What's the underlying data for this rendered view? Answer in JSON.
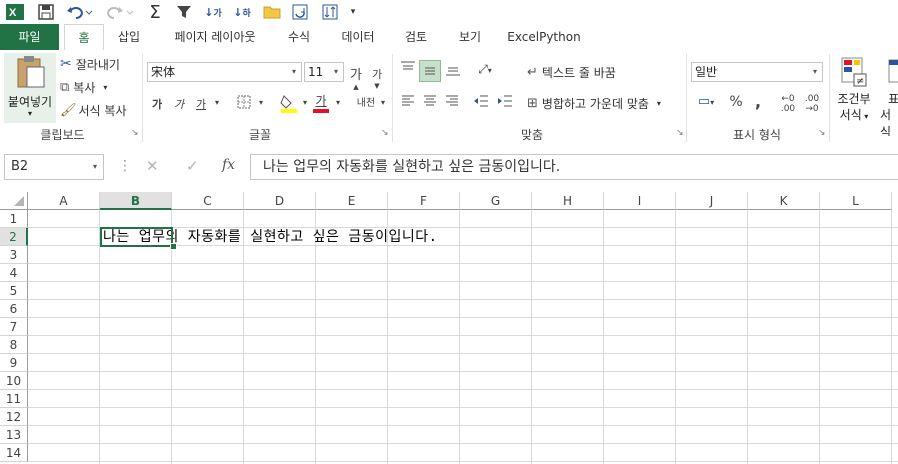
{
  "qat": {
    "icons": [
      "excel-logo",
      "save",
      "undo",
      "redo",
      "autosum",
      "filter",
      "sort-asc",
      "sort-desc",
      "open-folder",
      "refresh",
      "transpose",
      "customize"
    ]
  },
  "tabs": [
    "파일",
    "홈",
    "삽입",
    "페이지 레이아웃",
    "수식",
    "데이터",
    "검토",
    "보기",
    "ExcelPython"
  ],
  "ribbon": {
    "clipboard": {
      "paste": "붙여넣기",
      "cut": "잘라내기",
      "copy": "복사",
      "format_painter": "서식 복사",
      "label": "클립보드"
    },
    "font": {
      "name": "宋体",
      "size": "11",
      "grow": "가",
      "shrink": "가",
      "bold": "가",
      "italic": "가",
      "underline": "가",
      "font_color_letter": "가",
      "phonetic": "내천",
      "label": "글꼴"
    },
    "alignment": {
      "wrap": "텍스트 줄 바꿈",
      "merge": "병합하고 가운데 맞춤",
      "label": "맞춤"
    },
    "number": {
      "format": "일반",
      "percent": "%",
      "comma": ",",
      "label": "표시 형식"
    },
    "styles": {
      "conditional": "조건부",
      "conditional2": "서식",
      "table_format_partial": "표",
      "table_format_partial2": "서식"
    }
  },
  "formula_bar": {
    "name_box": "B2",
    "cancel": "✕",
    "enter": "✓",
    "fx": "fx",
    "content": "나는 업무의 자동화를 실현하고 싶은 금동이입니다."
  },
  "grid": {
    "columns": [
      "A",
      "B",
      "C",
      "D",
      "E",
      "F",
      "G",
      "H",
      "I",
      "J",
      "K",
      "L"
    ],
    "rows": [
      "1",
      "2",
      "3",
      "4",
      "5",
      "6",
      "7",
      "8",
      "9",
      "10",
      "11",
      "12",
      "13",
      "14"
    ],
    "selected_col": "B",
    "selected_row": "2",
    "cell_b2": "나는 업무의 자동화를 실현하고 싶은 금동이입니다."
  },
  "colors": {
    "accent": "#217346",
    "font_color_bar": "#e81123",
    "highlight_bar": "#ffff00"
  }
}
